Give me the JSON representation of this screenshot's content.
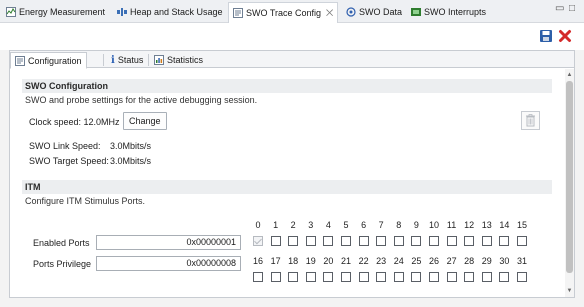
{
  "view_tabs": [
    {
      "label": "Energy Measurement",
      "icon": "energy-icon"
    },
    {
      "label": "Heap and Stack Usage",
      "icon": "heap-stack-icon"
    },
    {
      "label": "SWO Trace Config",
      "icon": "swo-config-icon",
      "active": true
    },
    {
      "label": "SWO Data",
      "icon": "swo-data-icon"
    },
    {
      "label": "SWO Interrupts",
      "icon": "swo-interrupts-icon"
    }
  ],
  "subtabs": [
    {
      "label": "Configuration",
      "icon": "configuration-icon",
      "active": true
    },
    {
      "label": "Status",
      "icon": "info-icon"
    },
    {
      "label": "Statistics",
      "icon": "statistics-icon"
    }
  ],
  "swo": {
    "heading": "SWO Configuration",
    "description": "SWO and probe settings for the active debugging session.",
    "clock_speed": "Clock speed: 12.0MHz",
    "change_label": "Change",
    "link_speed_label": "SWO Link Speed:",
    "link_speed_value": "3.0Mbits/s",
    "target_speed_label": "SWO Target Speed:",
    "target_speed_value": "3.0Mbits/s"
  },
  "itm": {
    "heading": "ITM",
    "description": "Configure ITM Stimulus Ports.",
    "enabled_ports_label": "Enabled Ports",
    "enabled_ports_value": "0x00000001",
    "ports_privilege_label": "Ports Privilege",
    "ports_privilege_value": "0x00000008",
    "bits_row1": [
      "0",
      "1",
      "2",
      "3",
      "4",
      "5",
      "6",
      "7",
      "8",
      "9",
      "10",
      "11",
      "12",
      "13",
      "14",
      "15"
    ],
    "bits_row2": [
      "16",
      "17",
      "18",
      "19",
      "20",
      "21",
      "22",
      "23",
      "24",
      "25",
      "26",
      "27",
      "28",
      "29",
      "30",
      "31"
    ],
    "checked_bits": [
      0
    ]
  },
  "colors": {
    "accent_red": "#d42a2a",
    "save_blue": "#2d5fa8",
    "section_bg": "#eceef0"
  }
}
